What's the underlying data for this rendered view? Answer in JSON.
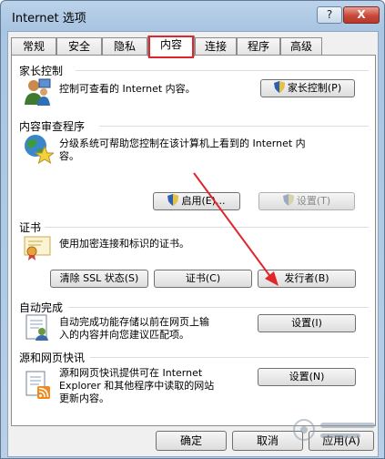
{
  "window": {
    "title": "Internet 选项",
    "help_label": "?",
    "close_label": "X"
  },
  "tabs": [
    {
      "label": "常规"
    },
    {
      "label": "安全"
    },
    {
      "label": "隐私"
    },
    {
      "label": "内容",
      "active": true
    },
    {
      "label": "连接"
    },
    {
      "label": "程序"
    },
    {
      "label": "高级"
    }
  ],
  "parental": {
    "title": "家长控制",
    "desc": "控制可查看的 Internet 内容。",
    "button": "家长控制(P)"
  },
  "advisor": {
    "title": "内容审查程序",
    "desc_line1": "分级系统可帮助您控制在该计算机上看到的 Internet 内",
    "desc_line2": "容。",
    "enable_button": "启用(E)...",
    "settings_button": "设置(T)"
  },
  "certificates": {
    "title": "证书",
    "desc": "使用加密连接和标识的证书。",
    "clear_ssl_button": "清除 SSL 状态(S)",
    "certificates_button": "证书(C)",
    "publishers_button": "发行者(B)"
  },
  "autocomplete": {
    "title": "自动完成",
    "desc_line1": "自动完成功能存储以前在网页上输",
    "desc_line2": "入的内容并向您建议匹配项。",
    "settings_button": "设置(I)"
  },
  "feeds": {
    "title": "源和网页快讯",
    "desc_line1": "源和网页快讯提供可在 Internet",
    "desc_line2": "Explorer 和其他程序中读取的网站",
    "desc_line3": "更新内容。",
    "settings_button": "设置(N)"
  },
  "footer": {
    "ok_button": "确定",
    "cancel_button": "取消",
    "apply_button": "应用(A)"
  },
  "colors": {
    "annotation": "#e0262b"
  }
}
